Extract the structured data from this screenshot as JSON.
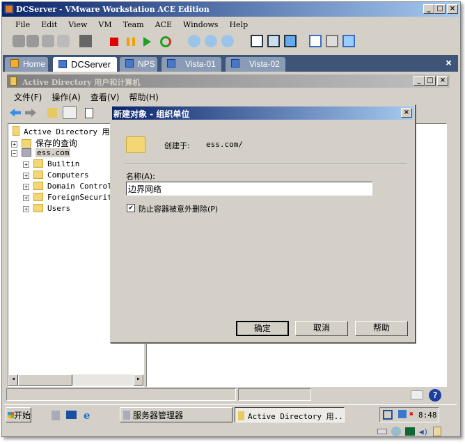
{
  "window": {
    "title": "DCServer - VMware Workstation ACE Edition"
  },
  "menu": [
    "File",
    "Edit",
    "View",
    "VM",
    "Team",
    "ACE",
    "Windows",
    "Help"
  ],
  "tabs": [
    {
      "label": "Home"
    },
    {
      "label": "DCServer",
      "active": true
    },
    {
      "label": "NPS"
    },
    {
      "label": "Vista-01"
    },
    {
      "label": "Vista-02"
    }
  ],
  "ad": {
    "title": "Active Directory 用户和计算机",
    "menu": [
      "文件(F)",
      "操作(A)",
      "查看(V)",
      "帮助(H)"
    ],
    "tree": [
      {
        "label": "Active Directory 用户"
      },
      {
        "label": "保存的查询"
      },
      {
        "label": "ess.com"
      },
      {
        "label": "Builtin"
      },
      {
        "label": "Computers"
      },
      {
        "label": "Domain Controllers"
      },
      {
        "label": "ForeignSecurityPrincipals"
      },
      {
        "label": "Users"
      }
    ]
  },
  "dialog": {
    "title": "新建对象 - 组织单位",
    "created_in_label": "创建于:",
    "created_in_value": "ess.com/",
    "name_label": "名称(A):",
    "name_value": "边界网络",
    "protect_label": "防止容器被意外删除(P)",
    "protect_checked": true,
    "ok": "确定",
    "cancel": "取消",
    "help": "帮助"
  },
  "taskbar": {
    "start": "开始",
    "items": [
      "服务器管理器",
      "Active Directory 用..."
    ],
    "clock": "8:48"
  },
  "colors": {
    "title_start": "#0a246a",
    "title_end": "#a6caf0",
    "tabstrip": "#3e5577"
  }
}
